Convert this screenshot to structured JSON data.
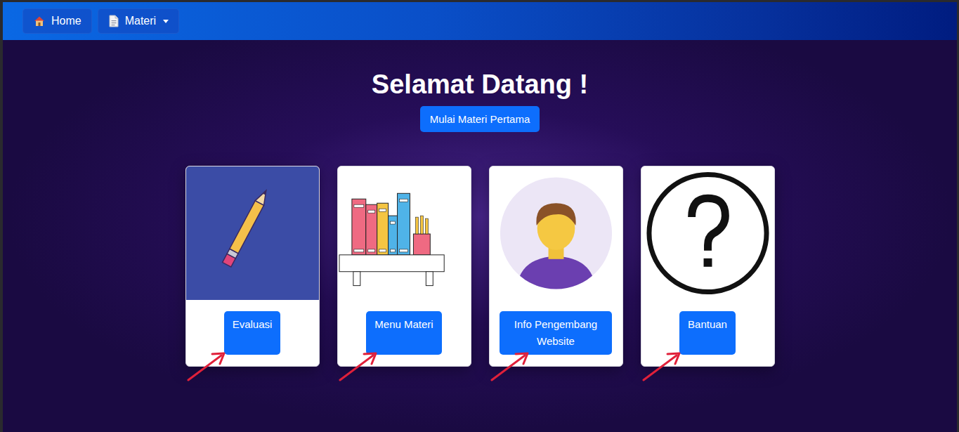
{
  "navbar": {
    "items": [
      {
        "label": "Home",
        "kind": "home",
        "has_menu": false
      },
      {
        "label": "Materi",
        "kind": "document",
        "has_menu": true
      }
    ]
  },
  "hero": {
    "title": "Selamat Datang !",
    "button": "Mulai Materi Pertama"
  },
  "cards": [
    {
      "kind": "pencil",
      "button": "Evaluasi",
      "arrow": true
    },
    {
      "kind": "bookshelf",
      "button": "Menu Materi",
      "arrow": true
    },
    {
      "kind": "avatar",
      "button": "Info Pengembang Website",
      "arrow": true
    },
    {
      "kind": "question",
      "button": "Bantuan",
      "arrow": true
    }
  ],
  "annotations": {
    "arrow_color": "#e0203a"
  }
}
